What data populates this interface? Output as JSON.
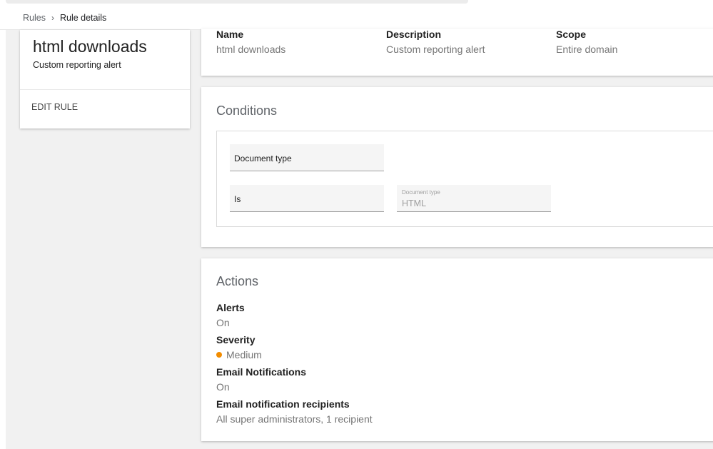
{
  "breadcrumb": {
    "root": "Rules",
    "separator": "›",
    "current": "Rule details"
  },
  "rule": {
    "title": "html downloads",
    "subtitle": "Custom reporting alert",
    "edit_label": "EDIT RULE"
  },
  "info": {
    "name_label": "Name",
    "name_value": "html downloads",
    "description_label": "Description",
    "description_value": "Custom reporting alert",
    "scope_label": "Scope",
    "scope_value": "Entire domain"
  },
  "conditions": {
    "title": "Conditions",
    "attribute": "Document type",
    "operator": "Is",
    "value_label": "Document type",
    "value": "HTML"
  },
  "actions": {
    "title": "Actions",
    "alerts_label": "Alerts",
    "alerts_value": "On",
    "severity_label": "Severity",
    "severity_value": "Medium",
    "severity_color": "#f28c00",
    "email_label": "Email Notifications",
    "email_value": "On",
    "recipients_label": "Email notification recipients",
    "recipients_value": "All super administrators, 1 recipient"
  }
}
